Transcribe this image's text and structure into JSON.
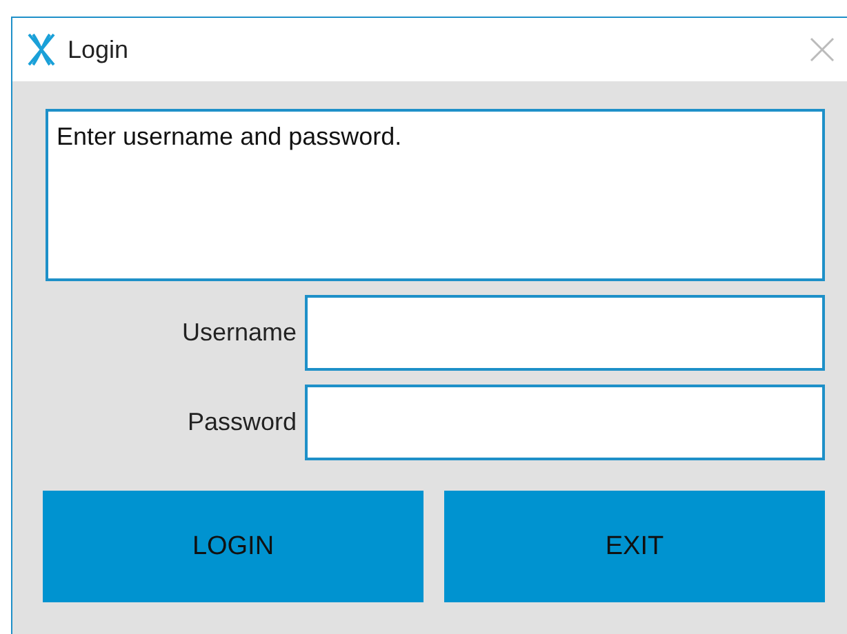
{
  "window": {
    "title": "Login"
  },
  "message": {
    "value": "Enter username and password."
  },
  "fields": [
    {
      "label": "Username"
    },
    {
      "label": "Password"
    }
  ],
  "buttons": [
    "LOGIN",
    "EXIT"
  ]
}
